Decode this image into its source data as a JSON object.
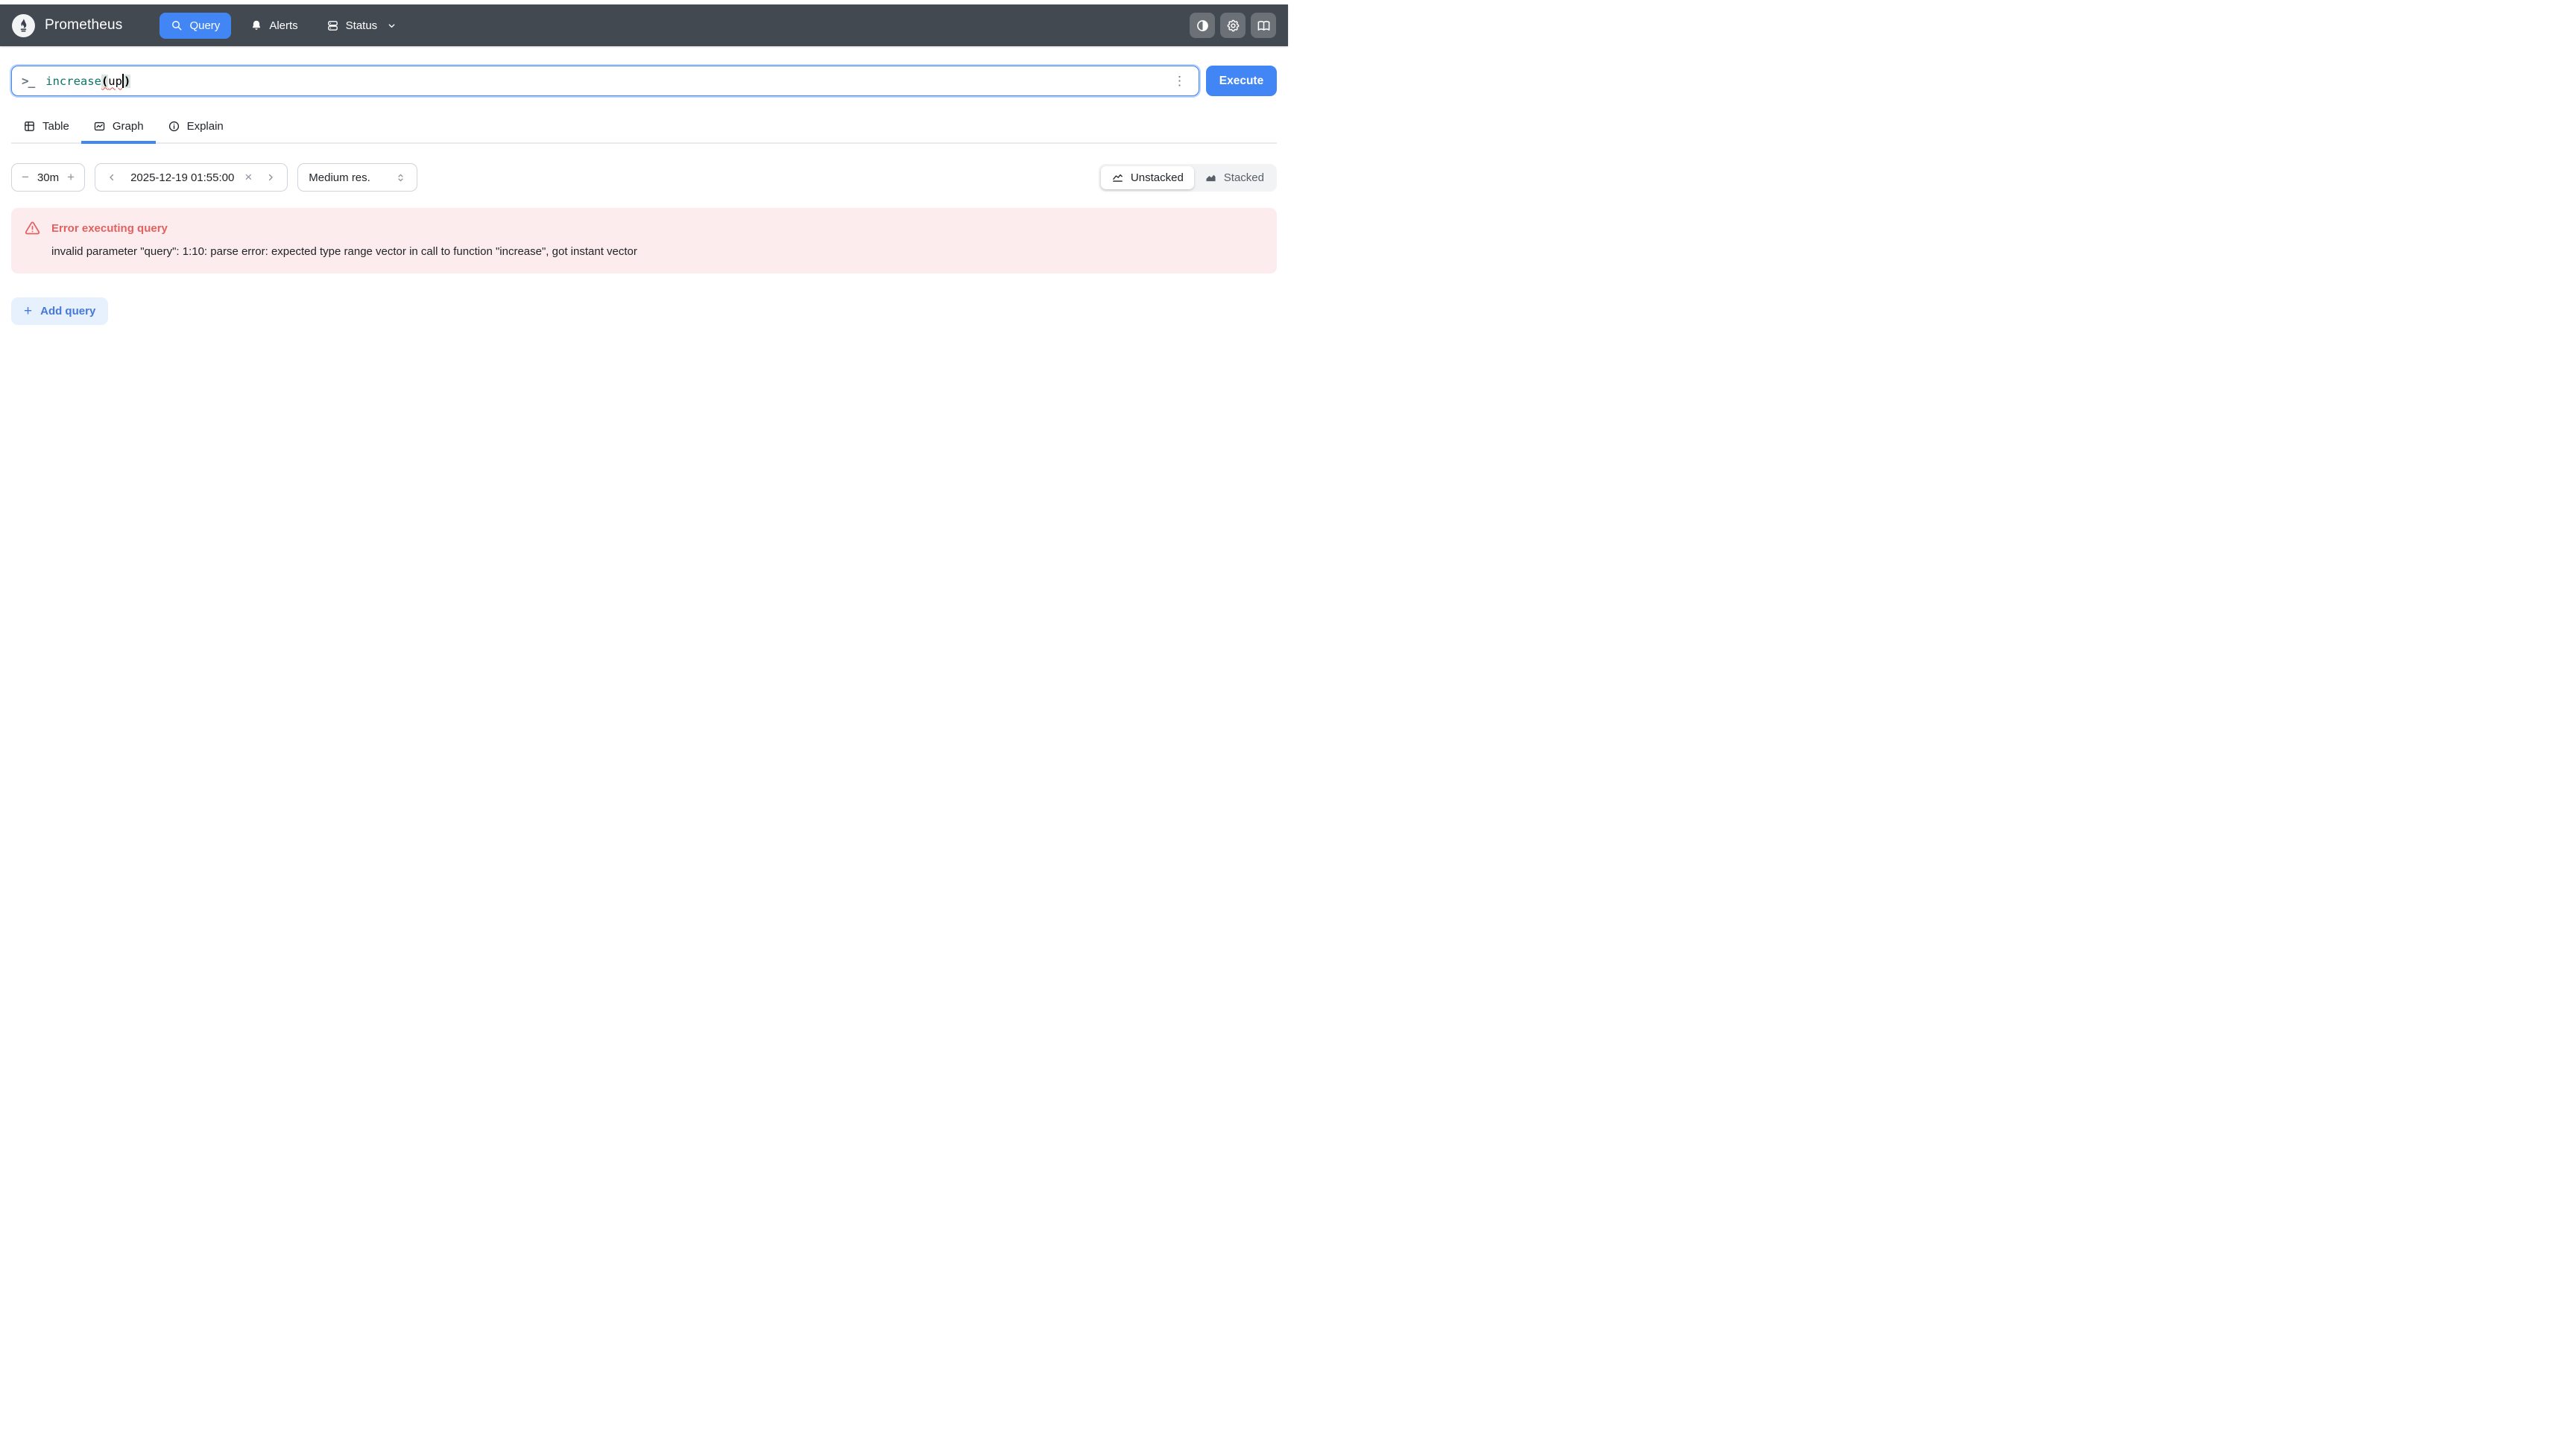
{
  "navbar": {
    "brand": "Prometheus",
    "nav": [
      {
        "label": "Query",
        "icon": "search-icon",
        "active": true
      },
      {
        "label": "Alerts",
        "icon": "bell-icon",
        "active": false
      },
      {
        "label": "Status",
        "icon": "database-icon",
        "active": false,
        "has_chevron": true
      }
    ],
    "icon_buttons": [
      {
        "name": "theme-toggle",
        "icon": "contrast-icon"
      },
      {
        "name": "settings",
        "icon": "gear-icon"
      },
      {
        "name": "documentation",
        "icon": "book-icon"
      }
    ]
  },
  "query": {
    "expression": {
      "fn": "increase",
      "open": "(",
      "arg": "up",
      "close": ")"
    },
    "execute": "Execute"
  },
  "icons": {
    "prompt": ">_",
    "kebab": "⋮",
    "minus": "−",
    "plus": "+",
    "close": "×",
    "add_plus": "+"
  },
  "tabs": [
    {
      "label": "Table",
      "icon": "table-icon",
      "active": false
    },
    {
      "label": "Graph",
      "icon": "graph-icon",
      "active": true
    },
    {
      "label": "Explain",
      "icon": "info-icon",
      "active": false
    }
  ],
  "toolbar": {
    "range": {
      "value": "30m"
    },
    "datetime": {
      "value": "2025-12-19 01:55:00"
    },
    "resolution": {
      "value": "Medium res."
    },
    "stacking": {
      "unstacked": "Unstacked",
      "stacked": "Stacked",
      "selected": "Unstacked"
    }
  },
  "alert": {
    "title": "Error executing query",
    "message": "invalid parameter \"query\": 1:10: parse error: expected type range vector in call to function \"increase\", got instant vector"
  },
  "actions": {
    "add_query": "Add query"
  },
  "colors": {
    "navbar_bg": "#424951",
    "accent_blue": "#4285f4",
    "function_teal": "#0e7569",
    "error_red": "#e2605f",
    "error_bg": "#fdeced",
    "add_query_bg": "#e7f0fd",
    "add_query_text": "#4678d8"
  }
}
